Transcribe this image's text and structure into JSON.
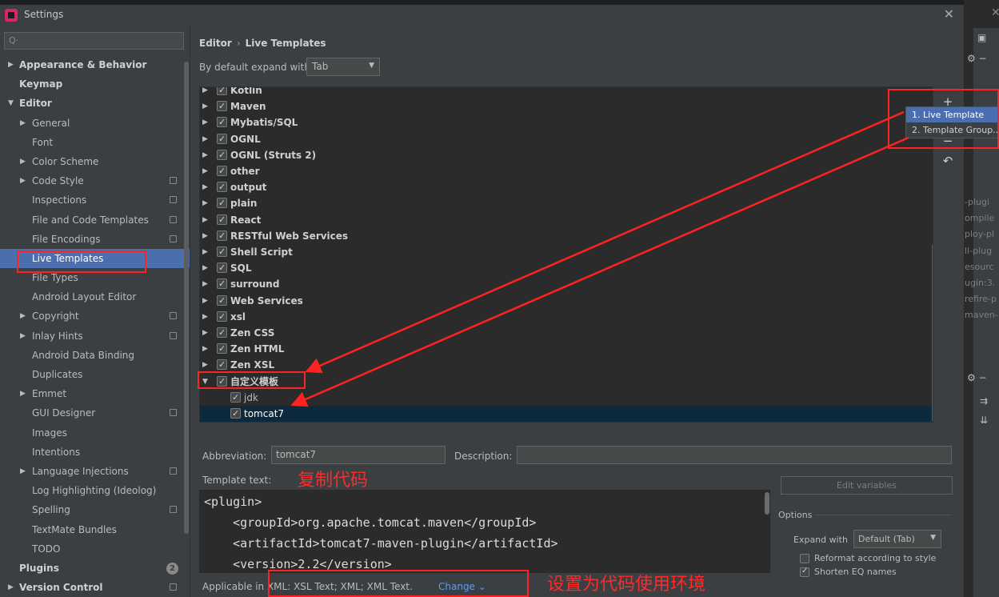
{
  "window": {
    "title": "Settings"
  },
  "search": {
    "placeholder": ""
  },
  "sidebar": {
    "items": [
      {
        "label": "Appearance & Behavior",
        "level": 0,
        "arrow": "▶",
        "bold": true
      },
      {
        "label": "Keymap",
        "level": 0,
        "arrow": "",
        "bold": true
      },
      {
        "label": "Editor",
        "level": 0,
        "arrow": "▼",
        "bold": true
      },
      {
        "label": "General",
        "level": 1,
        "arrow": "▶"
      },
      {
        "label": "Font",
        "level": 1,
        "arrow": ""
      },
      {
        "label": "Color Scheme",
        "level": 1,
        "arrow": "▶"
      },
      {
        "label": "Code Style",
        "level": 1,
        "arrow": "▶",
        "cfg": true
      },
      {
        "label": "Inspections",
        "level": 1,
        "arrow": "",
        "cfg": true
      },
      {
        "label": "File and Code Templates",
        "level": 1,
        "arrow": "",
        "cfg": true
      },
      {
        "label": "File Encodings",
        "level": 1,
        "arrow": "",
        "cfg": true
      },
      {
        "label": "Live Templates",
        "level": 1,
        "arrow": "",
        "selected": true
      },
      {
        "label": "File Types",
        "level": 1,
        "arrow": ""
      },
      {
        "label": "Android Layout Editor",
        "level": 1,
        "arrow": ""
      },
      {
        "label": "Copyright",
        "level": 1,
        "arrow": "▶",
        "cfg": true
      },
      {
        "label": "Inlay Hints",
        "level": 1,
        "arrow": "▶",
        "cfg": true
      },
      {
        "label": "Android Data Binding",
        "level": 1,
        "arrow": ""
      },
      {
        "label": "Duplicates",
        "level": 1,
        "arrow": ""
      },
      {
        "label": "Emmet",
        "level": 1,
        "arrow": "▶"
      },
      {
        "label": "GUI Designer",
        "level": 1,
        "arrow": "",
        "cfg": true
      },
      {
        "label": "Images",
        "level": 1,
        "arrow": ""
      },
      {
        "label": "Intentions",
        "level": 1,
        "arrow": ""
      },
      {
        "label": "Language Injections",
        "level": 1,
        "arrow": "▶",
        "cfg": true
      },
      {
        "label": "Log Highlighting (Ideolog)",
        "level": 1,
        "arrow": ""
      },
      {
        "label": "Spelling",
        "level": 1,
        "arrow": "",
        "cfg": true
      },
      {
        "label": "TextMate Bundles",
        "level": 1,
        "arrow": ""
      },
      {
        "label": "TODO",
        "level": 1,
        "arrow": ""
      },
      {
        "label": "Plugins",
        "level": 0,
        "arrow": "",
        "bold": true,
        "badge": "2"
      },
      {
        "label": "Version Control",
        "level": 0,
        "arrow": "▶",
        "bold": true,
        "cfg": true
      }
    ]
  },
  "breadcrumb": {
    "part1": "Editor",
    "sep": "›",
    "part2": "Live Templates"
  },
  "expand": {
    "label": "By default expand with",
    "value": "Tab"
  },
  "templates": [
    {
      "label": "Kotlin",
      "group": true,
      "arrow": "▶"
    },
    {
      "label": "Maven",
      "group": true,
      "arrow": "▶"
    },
    {
      "label": "Mybatis/SQL",
      "group": true,
      "arrow": "▶"
    },
    {
      "label": "OGNL",
      "group": true,
      "arrow": "▶"
    },
    {
      "label": "OGNL (Struts 2)",
      "group": true,
      "arrow": "▶"
    },
    {
      "label": "other",
      "group": true,
      "arrow": "▶"
    },
    {
      "label": "output",
      "group": true,
      "arrow": "▶"
    },
    {
      "label": "plain",
      "group": true,
      "arrow": "▶"
    },
    {
      "label": "React",
      "group": true,
      "arrow": "▶"
    },
    {
      "label": "RESTful Web Services",
      "group": true,
      "arrow": "▶"
    },
    {
      "label": "Shell Script",
      "group": true,
      "arrow": "▶"
    },
    {
      "label": "SQL",
      "group": true,
      "arrow": "▶"
    },
    {
      "label": "surround",
      "group": true,
      "arrow": "▶"
    },
    {
      "label": "Web Services",
      "group": true,
      "arrow": "▶"
    },
    {
      "label": "xsl",
      "group": true,
      "arrow": "▶"
    },
    {
      "label": "Zen CSS",
      "group": true,
      "arrow": "▶"
    },
    {
      "label": "Zen HTML",
      "group": true,
      "arrow": "▶"
    },
    {
      "label": "Zen XSL",
      "group": true,
      "arrow": "▶"
    },
    {
      "label": "自定义模板",
      "group": true,
      "arrow": "▼"
    },
    {
      "label": "jdk",
      "group": false,
      "arrow": ""
    },
    {
      "label": "tomcat7",
      "group": false,
      "arrow": "",
      "selected": true
    }
  ],
  "toolbar": {
    "add": "+",
    "remove": "−",
    "undo": "↶"
  },
  "popup": {
    "items": [
      "1. Live Template",
      "2. Template Group..."
    ]
  },
  "details": {
    "abbreviation_label": "Abbreviation:",
    "abbreviation_value": "tomcat7",
    "description_label": "Description:",
    "description_value": "",
    "template_text_label": "Template text:",
    "code_lines": [
      "<plugin>",
      "    <groupId>org.apache.tomcat.maven</groupId>",
      "    <artifactId>tomcat7-maven-plugin</artifactId>",
      "    <version>2.2</version>"
    ],
    "edit_variables": "Edit variables",
    "options_label": "Options",
    "expand_with_label": "Expand with",
    "expand_with_value": "Default (Tab)",
    "reformat_label": "Reformat according to style",
    "shorten_label": "Shorten EQ names",
    "applicable_label": "Applicable in XML: XSL Text; XML; XML Text.",
    "change_label": "Change ⌄"
  },
  "annotations": {
    "copy_code": "复制代码",
    "set_env": "设置为代码使用环境"
  },
  "right_panel": {
    "lines": [
      "-plugi",
      "ompile",
      "ploy-pl",
      "ll-plug",
      "esourc",
      "ugin:3.",
      "refire-p",
      "maven-"
    ]
  },
  "colors": {
    "accent": "#4b6eaf",
    "selected_row": "#0d293e",
    "annotation": "#ff2222",
    "link": "#589df6"
  }
}
